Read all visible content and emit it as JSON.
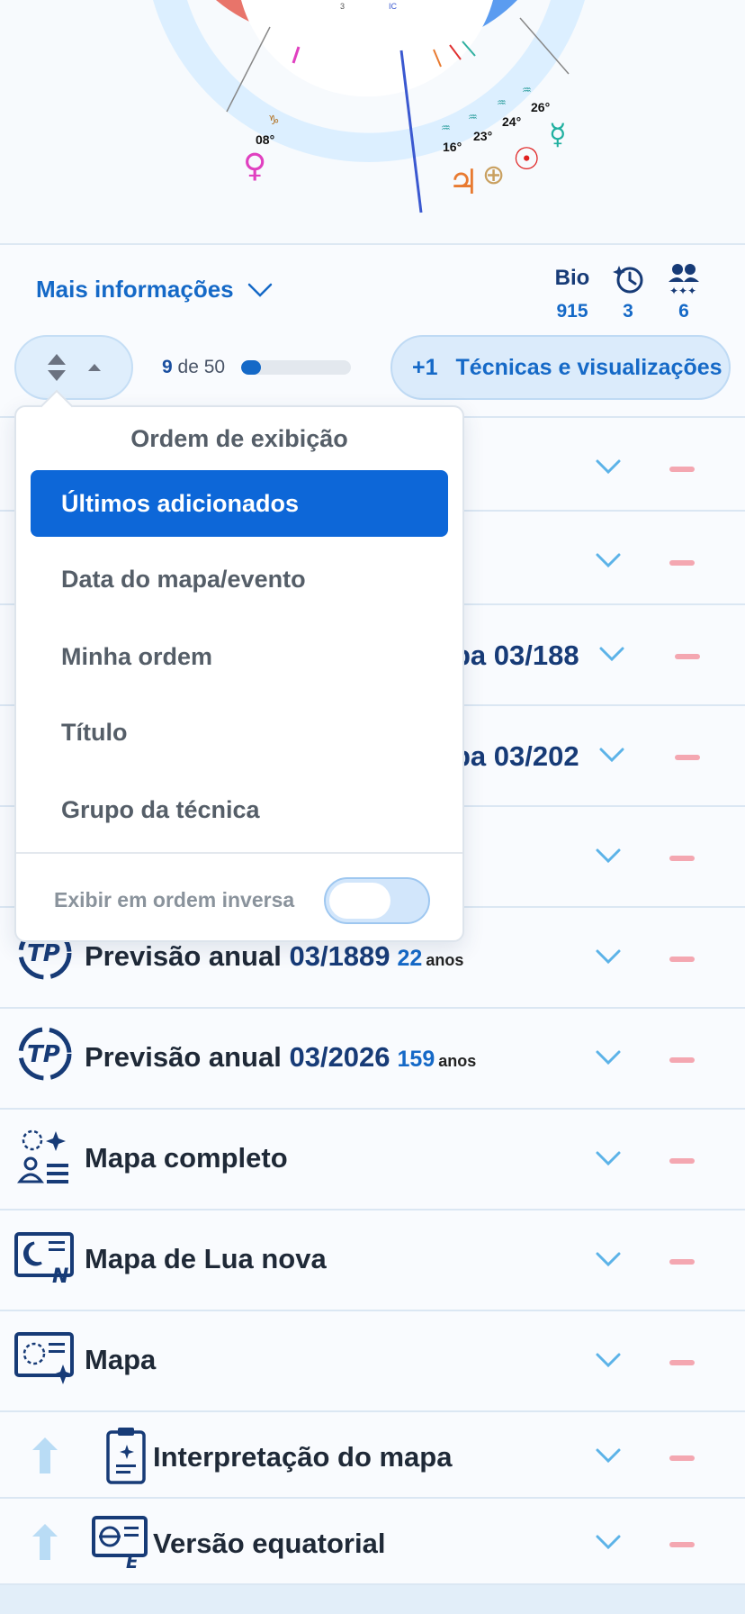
{
  "chart": {
    "degrees": [
      "08°",
      "16°",
      "23°",
      "24°",
      "26°"
    ],
    "house_labels": [
      "3",
      "IC"
    ]
  },
  "info": {
    "more_info_label": "Mais informações",
    "stats": [
      {
        "icon": "bio-icon",
        "icon_text": "Bio",
        "value": "915"
      },
      {
        "icon": "history-icon",
        "value": "3"
      },
      {
        "icon": "people-icon",
        "value": "6"
      }
    ]
  },
  "progress": {
    "current": "9",
    "separator": "de",
    "total": "50",
    "fraction": 0.18
  },
  "techniques_button": {
    "plus": "+1",
    "label": "Técnicas e visualizações"
  },
  "sort_menu": {
    "title": "Ordem de exibição",
    "options": [
      {
        "label": "Últimos adicionados",
        "selected": true
      },
      {
        "label": "Data do mapa/evento",
        "selected": false
      },
      {
        "label": "Minha ordem",
        "selected": false
      },
      {
        "label": "Título",
        "selected": false
      },
      {
        "label": "Grupo da técnica",
        "selected": false
      }
    ],
    "reverse_label": "Exibir em ordem inversa",
    "reverse_on": false
  },
  "list": {
    "partial_rows": [
      {
        "visible_tail": "pa 03/188"
      },
      {
        "visible_tail": "pa 03/202"
      }
    ],
    "rows": [
      {
        "title": "Previsão anual",
        "date": "03/1889",
        "age": "22",
        "unit": "anos"
      },
      {
        "title": "Previsão anual",
        "date": "03/2026",
        "age": "159",
        "unit": "anos"
      },
      {
        "title": "Mapa completo"
      },
      {
        "title": "Mapa de Lua nova"
      },
      {
        "title": "Mapa"
      },
      {
        "title": "Interpretação do mapa"
      },
      {
        "title": "Versão equatorial"
      }
    ]
  }
}
